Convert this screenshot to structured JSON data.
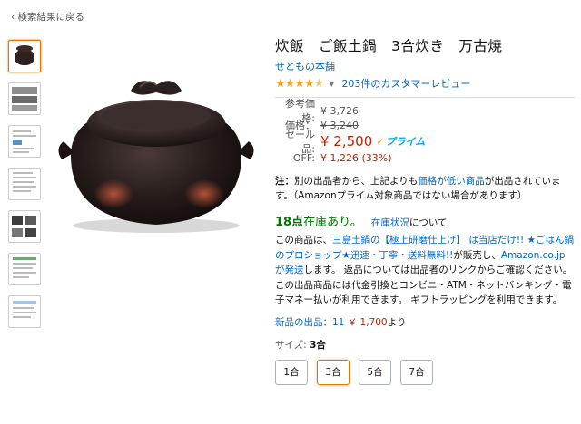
{
  "nav": {
    "back_link": "検索結果に戻る",
    "back_chevron": "‹"
  },
  "product": {
    "title": "炊飯　ご飯土鍋　3合炊き　万古焼",
    "brand": "せともの本舗",
    "rating": {
      "stars": 4.5,
      "reviews_label": "203件のカスタマーレビュー"
    }
  },
  "prices": {
    "reference": {
      "label": "参考価格:",
      "value": "¥ 3,726"
    },
    "list": {
      "label": "価格：",
      "value": "¥ 3,240"
    },
    "sale": {
      "label": "セール品:",
      "value": "¥ 2,500",
      "prime_label": "プライム"
    },
    "off": {
      "label": "OFF:",
      "value": "¥ 1,226 (33%)"
    }
  },
  "note": {
    "prefix": "注：",
    "text1": "別の出品者から、上記よりも",
    "link": "価格が低い商品",
    "text2": "が出品されています。（Amazonプライム対象商品ではない場合があります）"
  },
  "stock": {
    "count": "18点",
    "text": "在庫あり。",
    "link": "在庫状況",
    "suffix": "について"
  },
  "seller": {
    "text1": "この商品は、",
    "shop_link": "三島土鍋の【極上研磨仕上げ】 は当店だけ!! ★ごはん鍋のプロショップ★迅速・丁寧・送料無料!!",
    "text2": "が販売し、",
    "ship_link": "Amazon.co.jp が発送",
    "text3": "します。 返品については出品者のリンクからご確認ください。 この出品商品には代金引換とコンビニ・ATM・ネットバンキング・電子マネー払いが利用できます。 ギフトラッピングを利用できます。"
  },
  "new_items": {
    "label": "新品の出品：11",
    "price": "￥ 1,700",
    "suffix": "より"
  },
  "size": {
    "label": "サイズ:",
    "selected": "3合",
    "options": [
      "1合",
      "3合",
      "5合",
      "7合"
    ]
  },
  "colors": {
    "link": "#0066c0",
    "price": "#b12704",
    "stock": "#007600",
    "prime": "#00a8e1",
    "star": "#f4a41d",
    "selected_border": "#e77600"
  }
}
